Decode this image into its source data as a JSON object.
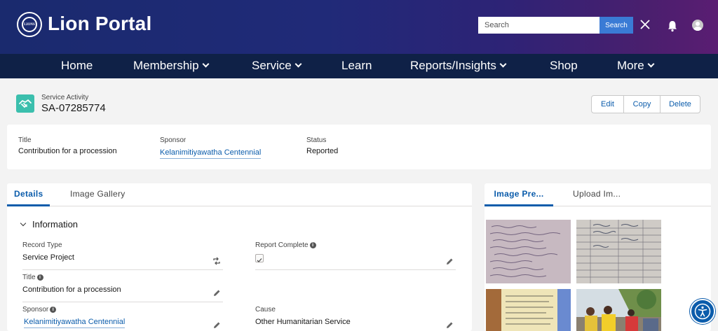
{
  "app": {
    "title": "Lion Portal",
    "logo_text": "LIONS"
  },
  "search": {
    "placeholder": "Search",
    "button_label": "Search"
  },
  "nav": [
    {
      "label": "Home",
      "has_menu": false
    },
    {
      "label": "Membership",
      "has_menu": true
    },
    {
      "label": "Service",
      "has_menu": true
    },
    {
      "label": "Learn",
      "has_menu": false
    },
    {
      "label": "Reports/Insights",
      "has_menu": true
    },
    {
      "label": "Shop",
      "has_menu": false
    },
    {
      "label": "More",
      "has_menu": true
    }
  ],
  "record": {
    "object_label": "Service Activity",
    "id": "SA-07285774",
    "actions": [
      "Edit",
      "Copy",
      "Delete"
    ]
  },
  "highlights": {
    "title_label": "Title",
    "title_value": "Contribution for a procession",
    "sponsor_label": "Sponsor",
    "sponsor_value": "Kelanimitiyawatha Centennial",
    "status_label": "Status",
    "status_value": "Reported"
  },
  "details": {
    "tabs": [
      "Details",
      "Image Gallery"
    ],
    "section_title": "Information",
    "fields": {
      "record_type_label": "Record Type",
      "record_type_value": "Service Project",
      "report_complete_label": "Report Complete",
      "report_complete_checked": true,
      "title_label": "Title",
      "title_value": "Contribution for a procession",
      "sponsor_label": "Sponsor",
      "sponsor_value": "Kelanimitiyawatha Centennial",
      "cause_label": "Cause",
      "cause_value": "Other Humanitarian Service"
    }
  },
  "image_panel": {
    "tabs": [
      "Image Pre...",
      "Upload Im..."
    ]
  },
  "colors": {
    "brand_dark": "#1a2a6e",
    "nav_bg": "#0f2147",
    "accent": "#0b5cab",
    "record_icon": "#3bbfad"
  }
}
